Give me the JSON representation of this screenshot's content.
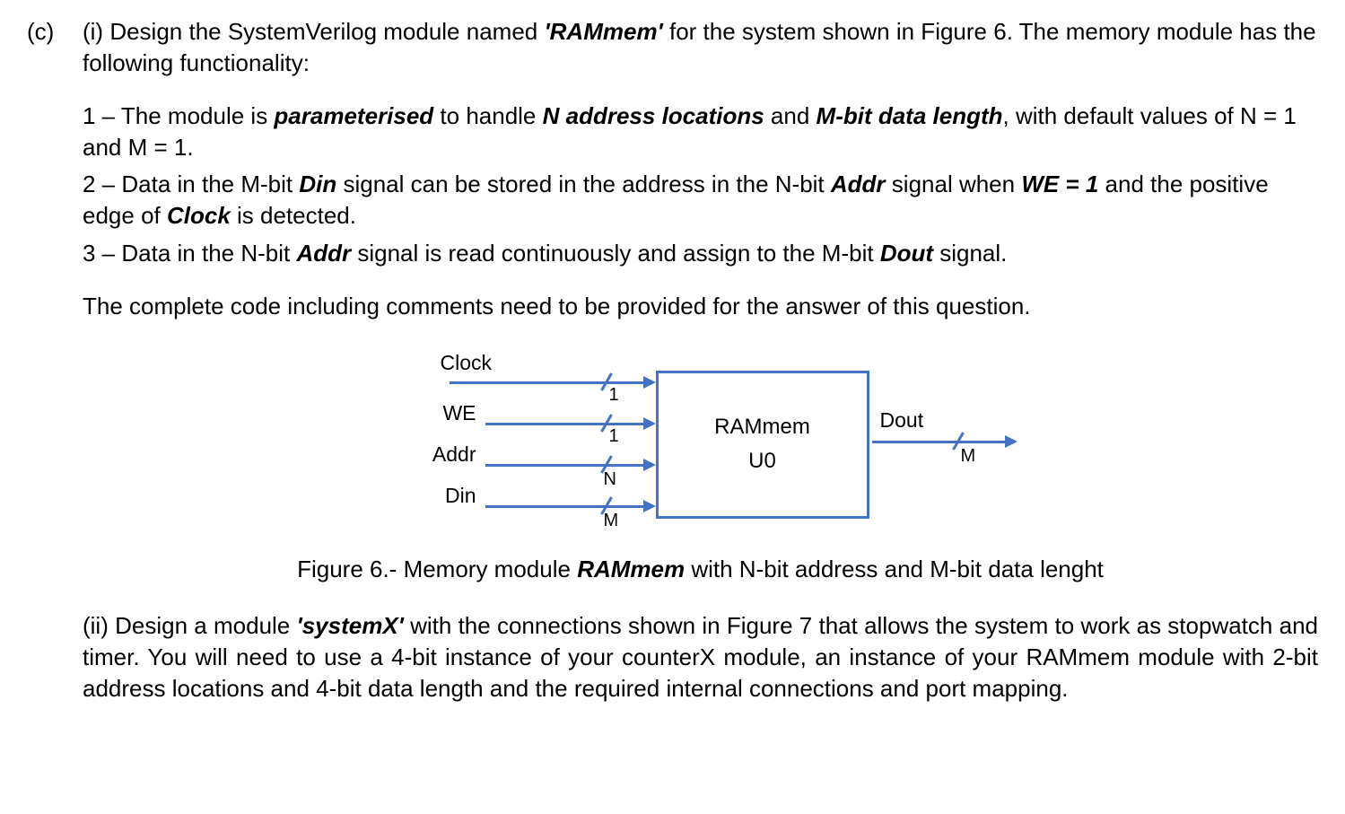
{
  "part_label": "(c)",
  "intro": {
    "sub_label": "(i)",
    "text_1": " Design the SystemVerilog module named ",
    "module_name": "'RAMmem'",
    "text_2": " for the system shown in Figure 6. The memory module has the following functionality:"
  },
  "req1": {
    "prefix": "1 – The module is ",
    "w1": "parameterised",
    "mid1": " to handle ",
    "w2": "N address locations",
    "mid2": " and ",
    "w3": "M-bit data length",
    "tail": ", with default values of N = 1 and M = 1."
  },
  "req2": {
    "prefix": "2 – Data in the M-bit ",
    "w1": "Din",
    "mid1": " signal can be stored in the address in the N-bit ",
    "w2": "Addr",
    "mid2": " signal when ",
    "w3": "WE = 1",
    "mid3": " and the positive edge of ",
    "w4": "Clock",
    "tail": " is detected."
  },
  "req3": {
    "prefix": "3 – Data in the N-bit ",
    "w1": "Addr",
    "mid1": " signal is read continuously and assign to the M-bit ",
    "w2": "Dout",
    "tail": " signal."
  },
  "note": "The complete code including comments need to be provided for the answer of this question.",
  "signals": {
    "clock": "Clock",
    "we": "WE",
    "addr": "Addr",
    "din": "Din",
    "dout": "Dout",
    "w_clock": "1",
    "w_we": "1",
    "w_addr": "N",
    "w_din": "M",
    "w_dout": "M"
  },
  "block": {
    "name": "RAMmem",
    "inst": "U0"
  },
  "caption": {
    "pre": "Figure 6.- Memory module ",
    "name": "RAMmem",
    "post": " with N-bit address and M-bit data lenght"
  },
  "part_ii": {
    "sub_label": "(ii)",
    "t1": " Design a module ",
    "w1": "'systemX'",
    "t2": " with the connections shown in Figure 7 that allows the system to work as stopwatch and timer. You will need to use a 4-bit instance of your counterX module, an instance of your RAMmem module with 2-bit address locations and 4-bit data length and the required internal connections and port mapping."
  }
}
